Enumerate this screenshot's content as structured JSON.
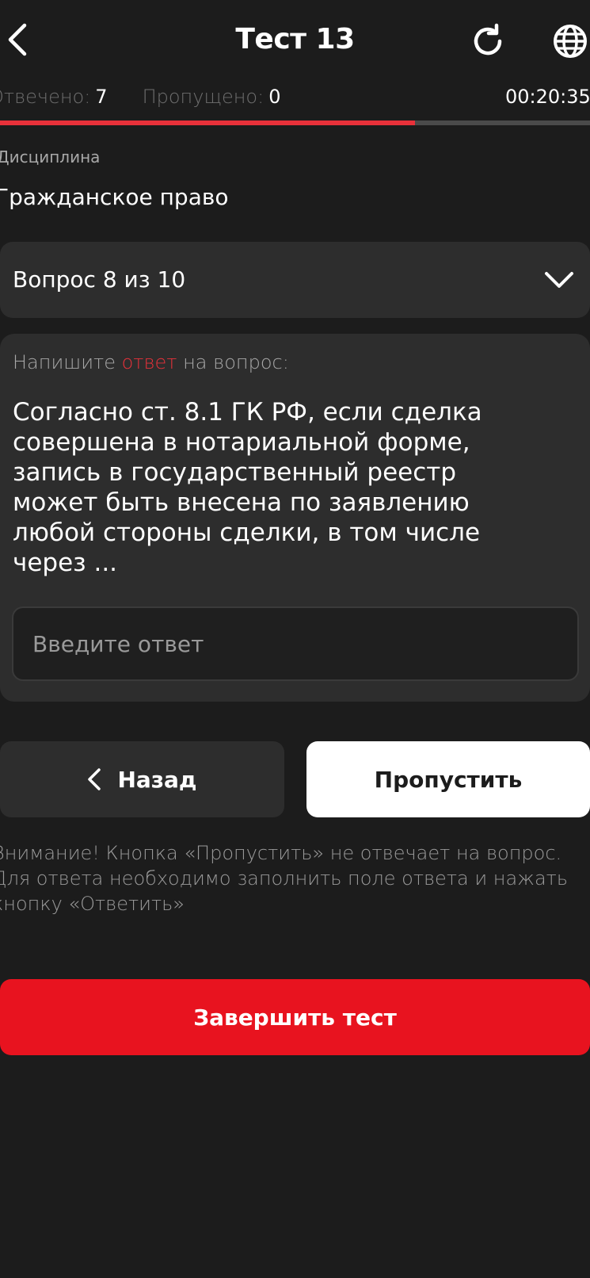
{
  "header": {
    "title": "Тест 13",
    "back_icon": "chevron-left-icon",
    "refresh_icon": "refresh-icon",
    "language_icon": "globe-icon"
  },
  "stats": {
    "answered_label": "Отвечено:",
    "answered_value": "7",
    "skipped_label": "Пропущено:",
    "skipped_value": "0",
    "timer": "00:20:35"
  },
  "progress": {
    "fraction": 0.704,
    "fill_color": "#e8313a",
    "track_color": "#4a4a4a"
  },
  "discipline": {
    "label": "Дисциплина",
    "value": "Гражданское право"
  },
  "question_select": {
    "label": "Вопрос 8 из 10",
    "icon": "chevron-down-icon"
  },
  "question": {
    "prompt_before": "Напишите ",
    "prompt_accent": "ответ",
    "prompt_after": " на вопрос:",
    "text": "Согласно ст. 8.1 ГК РФ, если сделка совершена в нотариальной форме, запись в государственный реестр может быть внесена по заявлению любой стороны сделки, в том числе через ...",
    "answer_placeholder": "Введите ответ",
    "answer_value": ""
  },
  "nav": {
    "back_label": "Назад",
    "skip_label": "Пропустить"
  },
  "notice": {
    "text": "Внимание! Кнопка «Пропустить» не отвечает на вопрос. Для ответа необходимо заполнить поле ответа и нажать кнопку «Ответить»"
  },
  "finish": {
    "label": "Завершить тест"
  },
  "colors": {
    "background": "#1c1c1c",
    "card": "#2d2d2d",
    "accent": "#e8313a",
    "finish": "#e8131f"
  }
}
